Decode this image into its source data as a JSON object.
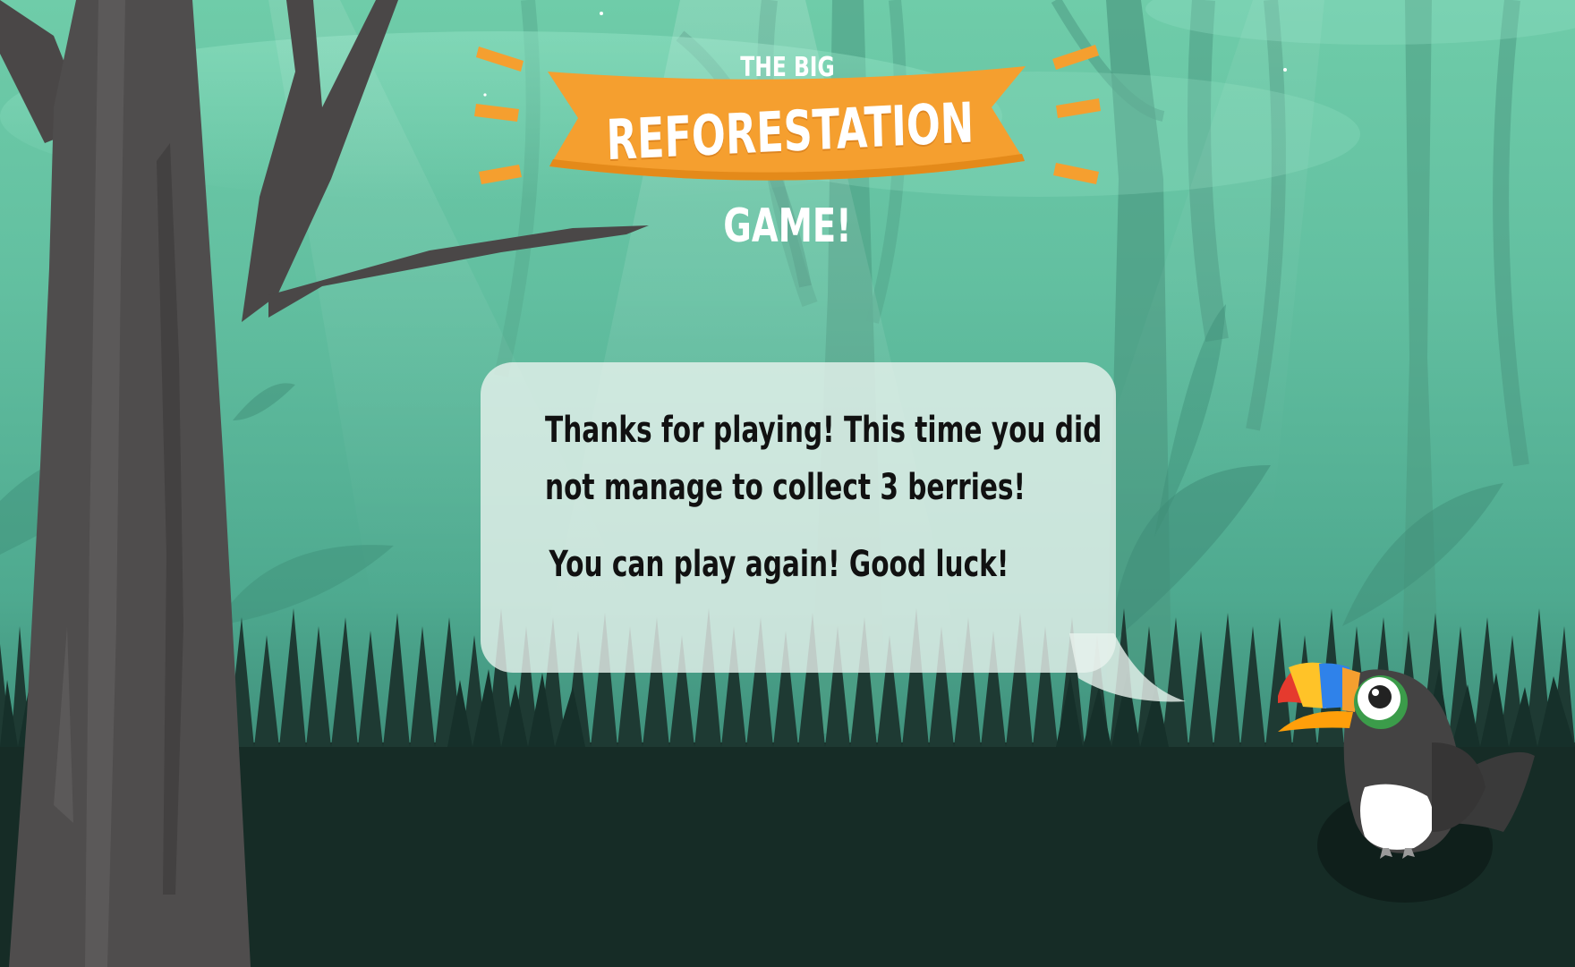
{
  "game": {
    "title_top": "THE BIG",
    "title_main": "REFORESTATION",
    "title_bottom": "GAME!"
  },
  "dialog": {
    "lines": [
      "Thanks for playing! This time you did",
      "not manage to collect 3 berries!"
    ],
    "retry_line": "You can play again! Good luck!"
  },
  "character": {
    "name": "toucan-icon"
  },
  "colors": {
    "banner": "#f59f2f",
    "sky_top": "#6fcca9",
    "ground": "#162c26",
    "tree": "#4f4d4d",
    "bubble": "#e9f2ee"
  }
}
